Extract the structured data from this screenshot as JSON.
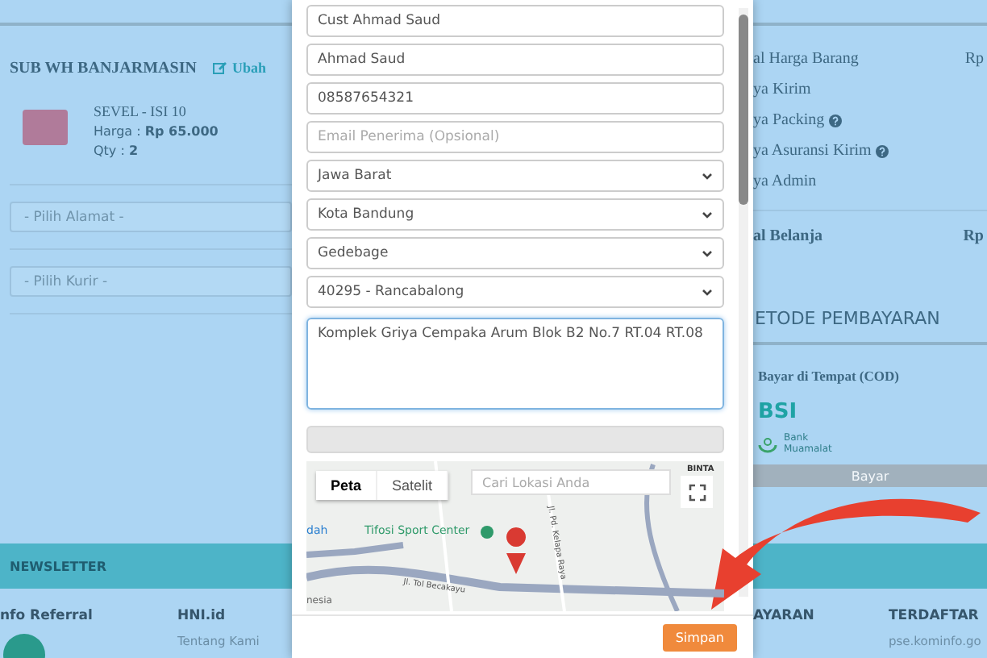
{
  "cart": {
    "store": "SUB WH BANJARMASIN",
    "edit_link": "Ubah",
    "product": {
      "name": "SEVEL - ISI 10",
      "price": "Harga : **Rp 65.000**",
      "qty": "Qty : **2**"
    },
    "address_select": {
      "placeholder": "- Pilih Alamat -"
    },
    "courier_select": {
      "placeholder": "- Pilih Kurir -"
    }
  },
  "summary": {
    "rows": [
      {
        "label": "al Harga Barang",
        "value": "Rp",
        "help": false
      },
      {
        "label": "ya Kirim",
        "help": false
      },
      {
        "label": "ya Packing",
        "help": true
      },
      {
        "label": "ya Asuransi Kirim",
        "help": true
      },
      {
        "label": "ya Admin",
        "help": false
      }
    ],
    "total": {
      "label": "al Belanja",
      "value": "Rp"
    }
  },
  "payment": {
    "title": "ETODE PEMBAYARAN",
    "options": [
      {
        "kind": "text",
        "label": "Bayar di Tempat (COD)"
      },
      {
        "kind": "bsi",
        "label": "BSI"
      },
      {
        "kind": "muamalat",
        "label": "Bank",
        "sublabel": "Muamalat"
      }
    ],
    "button": "Bayar"
  },
  "newsletter": {
    "title": "NEWSLETTER"
  },
  "footer": {
    "columns": [
      {
        "title": "nfo Referral",
        "logo": true
      },
      {
        "title": "HNI.id",
        "links": [
          "Tentang Kami"
        ]
      },
      {
        "title": "AYARAN"
      },
      {
        "title": "TERDAFTAR",
        "links": [
          "pse.kominfo.go"
        ]
      }
    ]
  },
  "modal": {
    "fields": [
      {
        "kind": "input",
        "value": "Cust Ahmad Saud"
      },
      {
        "kind": "input",
        "value": "Ahmad Saud"
      },
      {
        "kind": "input",
        "value": "08587654321"
      },
      {
        "kind": "input",
        "placeholder": "Email Penerima (Opsional)"
      },
      {
        "kind": "select",
        "value": "Jawa Barat"
      },
      {
        "kind": "select",
        "value": "Kota Bandung"
      },
      {
        "kind": "select",
        "value": "Gedebage"
      },
      {
        "kind": "select",
        "value": "40295 - Rancabalong"
      },
      {
        "kind": "textarea",
        "value": "Komplek Griya Cempaka Arum Blok B2 No.7 RT.04 RT.08"
      },
      {
        "kind": "readonly"
      }
    ],
    "map": {
      "tabs": [
        {
          "label": "Peta",
          "selected": true
        },
        {
          "label": "Satelit",
          "selected": false
        }
      ],
      "search": {
        "placeholder": "Cari Lokasi Anda"
      },
      "places": [
        "BINTA",
        "dah",
        "Tifosi Sport Center",
        "nesia"
      ],
      "roads": [
        "Jl. Tol Becakayu",
        "Jl. Pd. Kelapa Raya"
      ]
    },
    "save_button": "Simpan"
  }
}
